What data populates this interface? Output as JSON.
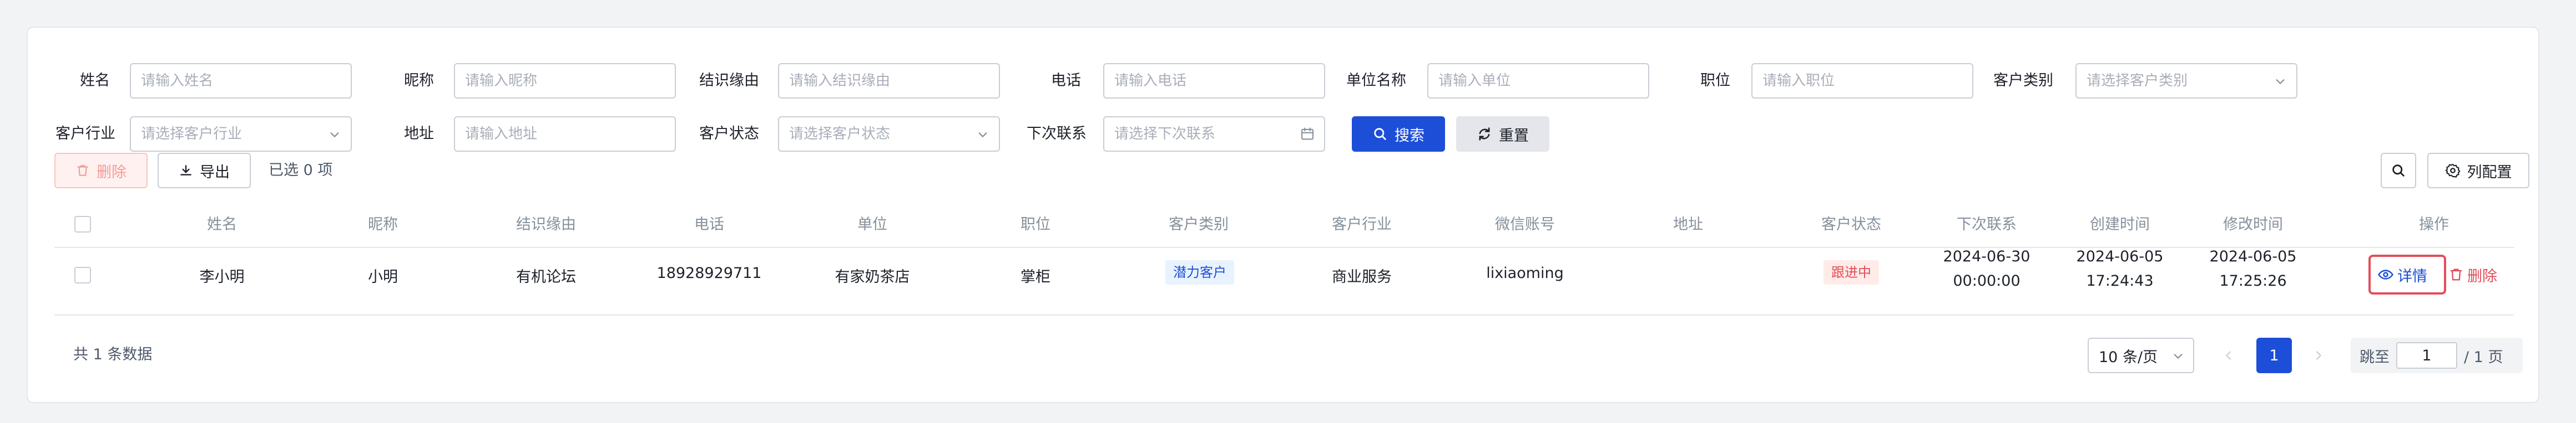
{
  "filters": {
    "name": {
      "label": "姓名",
      "placeholder": "请输入姓名"
    },
    "nickname": {
      "label": "昵称",
      "placeholder": "请输入昵称"
    },
    "reason": {
      "label": "结识缘由",
      "placeholder": "请输入结识缘由"
    },
    "phone": {
      "label": "电话",
      "placeholder": "请输入电话"
    },
    "company": {
      "label": "单位名称",
      "placeholder": "请输入单位"
    },
    "position": {
      "label": "职位",
      "placeholder": "请输入职位"
    },
    "category": {
      "label": "客户类别",
      "placeholder": "请选择客户类别"
    },
    "industry": {
      "label": "客户行业",
      "placeholder": "请选择客户行业"
    },
    "address": {
      "label": "地址",
      "placeholder": "请输入地址"
    },
    "status": {
      "label": "客户状态",
      "placeholder": "请选择客户状态"
    },
    "next_contact": {
      "label": "下次联系",
      "placeholder": "请选择下次联系"
    }
  },
  "actions": {
    "search": "搜索",
    "reset": "重置",
    "delete": "删除",
    "export": "导出",
    "selected": "已选 0 项",
    "column_config": "列配置"
  },
  "table": {
    "columns": [
      "姓名",
      "昵称",
      "结识缘由",
      "电话",
      "单位",
      "职位",
      "客户类别",
      "客户行业",
      "微信账号",
      "地址",
      "客户状态",
      "下次联系",
      "创建时间",
      "修改时间",
      "操作"
    ],
    "rows": [
      {
        "name": "李小明",
        "nickname": "小明",
        "reason": "有机论坛",
        "phone": "18928929711",
        "company": "有家奶茶店",
        "position": "掌柜",
        "category": "潜力客户",
        "industry": "商业服务",
        "wechat": "lixiaoming",
        "address": "",
        "status": "跟进中",
        "next_contact_date": "2024-06-30",
        "next_contact_time": "00:00:00",
        "created_date": "2024-06-05",
        "created_time": "17:24:43",
        "modified_date": "2024-06-05",
        "modified_time": "17:25:26",
        "detail": "详情",
        "delete": "删除"
      }
    ]
  },
  "pagination": {
    "total": "共 1 条数据",
    "page_size": "10 条/页",
    "current_page": "1",
    "jump_label": "跳至",
    "jump_value": "1",
    "total_pages": "/ 1 页"
  },
  "colors": {
    "primary": "#1d4ed8",
    "danger": "#e34d59",
    "tag_blue_bg": "#e8f3ff",
    "tag_red_bg": "#ffece8"
  }
}
